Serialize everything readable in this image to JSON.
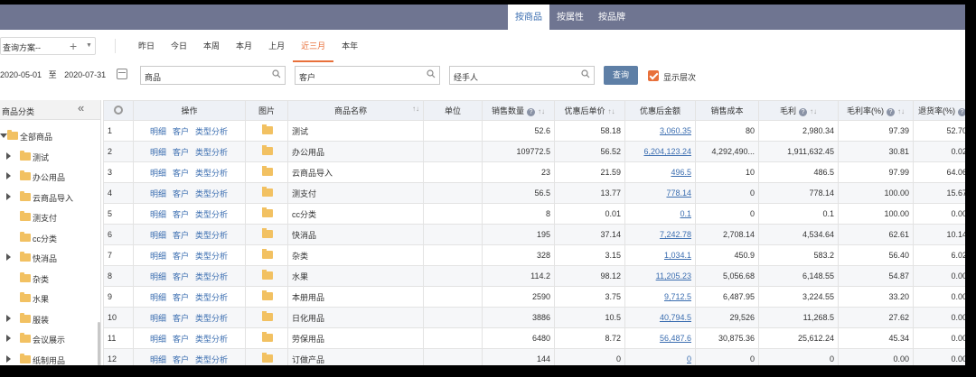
{
  "nav": {
    "tabs": [
      "按商品",
      "按属性",
      "按品牌"
    ],
    "active": 0
  },
  "toolbar": {
    "scheme": "查询方案--",
    "periods": [
      "昨日",
      "今日",
      "本周",
      "本月",
      "上月",
      "近三月",
      "本年"
    ],
    "active_period": 5
  },
  "filters": {
    "date_start": "2020-05-01",
    "date_sep": "至",
    "date_end": "2020-07-31",
    "product": "商品",
    "customer": "客户",
    "handler": "经手人",
    "query_button": "查询",
    "show_level": "显示层次"
  },
  "tree": {
    "header": "商品分类",
    "nodes": [
      {
        "label": "全部商品",
        "level": 0,
        "arrow": "down"
      },
      {
        "label": "测试",
        "level": 1,
        "arrow": "right"
      },
      {
        "label": "办公用品",
        "level": 1,
        "arrow": "right"
      },
      {
        "label": "云商品导入",
        "level": 1,
        "arrow": "right"
      },
      {
        "label": "测支付",
        "level": 1,
        "arrow": ""
      },
      {
        "label": "cc分类",
        "level": 1,
        "arrow": ""
      },
      {
        "label": "快消品",
        "level": 1,
        "arrow": "right"
      },
      {
        "label": "杂类",
        "level": 1,
        "arrow": ""
      },
      {
        "label": "水果",
        "level": 1,
        "arrow": ""
      },
      {
        "label": "服装",
        "level": 1,
        "arrow": "right"
      },
      {
        "label": "会议展示",
        "level": 1,
        "arrow": "right"
      },
      {
        "label": "纸制用品",
        "level": 1,
        "arrow": "right"
      }
    ]
  },
  "table": {
    "headers": {
      "op": "操作",
      "img": "图片",
      "name": "商品名称",
      "unit": "单位",
      "qty": "销售数量",
      "price": "优惠后单价",
      "amount": "优惠后金额",
      "cost": "销售成本",
      "profit": "毛利",
      "rate": "毛利率(%)",
      "return_rate": "退货率(%)"
    },
    "ops": [
      "明细",
      "客户",
      "类型分析"
    ],
    "rows": [
      {
        "no": "1",
        "name": "测试",
        "qty": "52.6",
        "price": "58.18",
        "amount": "3,060.35",
        "cost": "80",
        "profit": "2,980.34",
        "rate": "97.39",
        "ret": "52.70"
      },
      {
        "no": "2",
        "name": "办公用品",
        "qty": "109772.5",
        "price": "56.52",
        "amount": "6,204,123.24",
        "cost": "4,292,490...",
        "profit": "1,911,632.45",
        "rate": "30.81",
        "ret": "0.02"
      },
      {
        "no": "3",
        "name": "云商品导入",
        "qty": "23",
        "price": "21.59",
        "amount": "496.5",
        "cost": "10",
        "profit": "486.5",
        "rate": "97.99",
        "ret": "64.06"
      },
      {
        "no": "4",
        "name": "测支付",
        "qty": "56.5",
        "price": "13.77",
        "amount": "778.14",
        "cost": "0",
        "profit": "778.14",
        "rate": "100.00",
        "ret": "15.67"
      },
      {
        "no": "5",
        "name": "cc分类",
        "qty": "8",
        "price": "0.01",
        "amount": "0.1",
        "cost": "0",
        "profit": "0.1",
        "rate": "100.00",
        "ret": "0.00"
      },
      {
        "no": "6",
        "name": "快消品",
        "qty": "195",
        "price": "37.14",
        "amount": "7,242.78",
        "cost": "2,708.14",
        "profit": "4,534.64",
        "rate": "62.61",
        "ret": "10.14"
      },
      {
        "no": "7",
        "name": "杂类",
        "qty": "328",
        "price": "3.15",
        "amount": "1,034.1",
        "cost": "450.9",
        "profit": "583.2",
        "rate": "56.40",
        "ret": "6.02"
      },
      {
        "no": "8",
        "name": "水果",
        "qty": "114.2",
        "price": "98.12",
        "amount": "11,205.23",
        "cost": "5,056.68",
        "profit": "6,148.55",
        "rate": "54.87",
        "ret": "0.00"
      },
      {
        "no": "9",
        "name": "本册用品",
        "qty": "2590",
        "price": "3.75",
        "amount": "9,712.5",
        "cost": "6,487.95",
        "profit": "3,224.55",
        "rate": "33.20",
        "ret": "0.00"
      },
      {
        "no": "10",
        "name": "日化用品",
        "qty": "3886",
        "price": "10.5",
        "amount": "40,794.5",
        "cost": "29,526",
        "profit": "11,268.5",
        "rate": "27.62",
        "ret": "0.00"
      },
      {
        "no": "11",
        "name": "劳保用品",
        "qty": "6480",
        "price": "8.72",
        "amount": "56,487.6",
        "cost": "30,875.36",
        "profit": "25,612.24",
        "rate": "45.34",
        "ret": "0.00"
      },
      {
        "no": "12",
        "name": "订做产品",
        "qty": "144",
        "price": "0",
        "amount": "0",
        "cost": "0",
        "profit": "0",
        "rate": "0.00",
        "ret": "0.00"
      }
    ]
  },
  "colors": {
    "nav": "#6f7591",
    "accent": "#e8703a",
    "link": "#3a6db0",
    "button": "#5e7fa6",
    "folder": "#f2c162"
  }
}
